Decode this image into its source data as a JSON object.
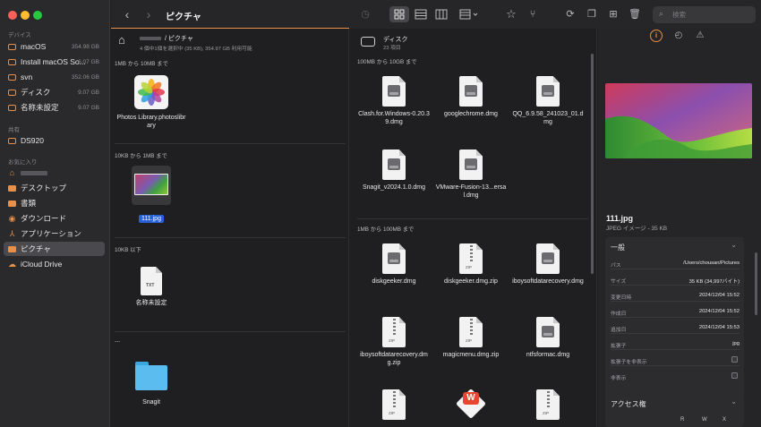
{
  "sidebar": {
    "sections": {
      "devices": "デバイス",
      "shared": "共有",
      "favorites": "お気に入り"
    },
    "devices": [
      {
        "label": "macOS",
        "size": "354.98 GB"
      },
      {
        "label": "Install macOS So...",
        "size": "6.07 GB"
      },
      {
        "label": "svn",
        "size": "352.06 GB"
      },
      {
        "label": "ディスク",
        "size": "9.07 GB"
      },
      {
        "label": "名称未設定",
        "size": "9.07 GB"
      }
    ],
    "shared": [
      {
        "label": "DS920"
      }
    ],
    "favorites": [
      {
        "label": ""
      },
      {
        "label": "デスクトップ"
      },
      {
        "label": "書類"
      },
      {
        "label": "ダウンロード"
      },
      {
        "label": "アプリケーション"
      },
      {
        "label": "ピクチャ"
      },
      {
        "label": "iCloud Drive"
      }
    ]
  },
  "toolbar": {
    "title": "ピクチャ",
    "search_placeholder": "検索"
  },
  "pane1": {
    "path_sep": "/ ピクチャ",
    "status": "4 個中1個を選択中 (35 KB), 354.97 GB 利用可能",
    "groups": [
      {
        "label": "1MB から 10MB まで",
        "items": [
          {
            "name": "Photos Library.photoslibrary"
          }
        ]
      },
      {
        "label": "10KB から 1MB まで",
        "items": [
          {
            "name": "111.jpg"
          }
        ]
      },
      {
        "label": "10KB 以下",
        "items": [
          {
            "name": "名称未設定",
            "tag": "TXT"
          }
        ]
      },
      {
        "label": "---",
        "items": [
          {
            "name": "Snagit"
          }
        ]
      }
    ]
  },
  "pane2": {
    "name": "ディスク",
    "count": "23 項目",
    "groups": [
      {
        "label": "100MB から 10GB まで",
        "items": [
          {
            "name": "Clash.for.Windows-0.20.39.dmg"
          },
          {
            "name": "googlechrome.dmg"
          },
          {
            "name": "QQ_6.9.58_241023_01.dmg"
          },
          {
            "name": "Snagit_v2024.1.0.dmg"
          },
          {
            "name": "VMware-Fusion-13...ersal.dmg"
          }
        ]
      },
      {
        "label": "1MB から 100MB まで",
        "items": [
          {
            "name": "diskgeeker.dmg"
          },
          {
            "name": "diskgeeker.dmg.zip",
            "tag": "ZIP"
          },
          {
            "name": "iboysoftdatarecovery.dmg"
          },
          {
            "name": "iboysoftdatarecovery.dmg.zip",
            "tag": "ZIP"
          },
          {
            "name": "magicmenu.dmg.zip",
            "tag": "ZIP"
          },
          {
            "name": "ntfsformac.dmg"
          },
          {
            "name": "",
            "tag": "ZIP"
          },
          {
            "name": ""
          },
          {
            "name": "",
            "tag": "ZIP"
          }
        ]
      }
    ]
  },
  "info": {
    "filename": "111.jpg",
    "kind": "JPEG イメージ - 35 KB",
    "general_title": "一般",
    "rows": [
      {
        "k": "パス",
        "v": "/Users/chousan/Pictures"
      },
      {
        "k": "サイズ",
        "v": "35 KB (34,997バイト)"
      },
      {
        "k": "変更日時",
        "v": "2024/12/04 15:52"
      },
      {
        "k": "作成日",
        "v": "2024/12/04 15:52"
      },
      {
        "k": "追加日",
        "v": "2024/12/04 15:53"
      },
      {
        "k": "拡張子",
        "v": "jpg"
      },
      {
        "k": "拡張子を非表示",
        "v": ""
      },
      {
        "k": "非表示",
        "v": ""
      }
    ],
    "access_title": "アクセス権",
    "access_cols": [
      "R",
      "W",
      "X"
    ]
  },
  "colors": {
    "accent": "#e8904a",
    "selection": "#2a5fd6"
  }
}
